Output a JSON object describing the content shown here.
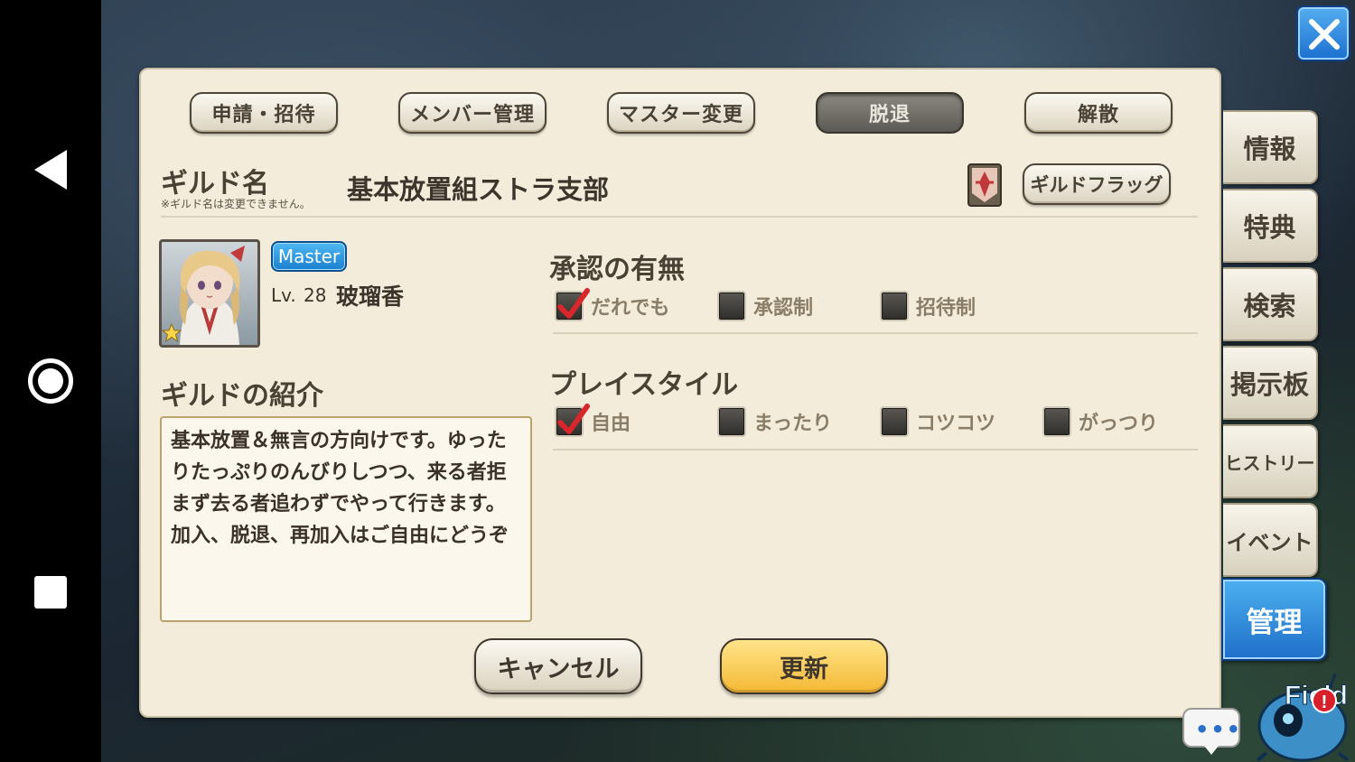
{
  "close_icon": "close-icon",
  "android_nav": {
    "back": "back-icon",
    "home": "home-icon",
    "recent": "recent-apps-icon"
  },
  "tabs": [
    {
      "label": "申請・招待",
      "active": false
    },
    {
      "label": "メンバー管理",
      "active": false
    },
    {
      "label": "マスター変更",
      "active": false
    },
    {
      "label": "脱退",
      "active": true
    },
    {
      "label": "解散",
      "active": false
    }
  ],
  "guild": {
    "name_label": "ギルド名",
    "name_note": "※ギルド名は変更できません。",
    "name": "基本放置組ストラ支部",
    "flag_button": "ギルドフラッグ"
  },
  "member": {
    "badge": "Master",
    "level_label": "Lv.",
    "level": "28",
    "name": "玻瑠香"
  },
  "intro": {
    "heading": "ギルドの紹介",
    "text": "基本放置＆無言の方向けです。ゆったりたっぷりのんびりしつつ、来る者拒まず去る者追わずでやって行きます。加入、脱退、再加入はご自由にどうぞ"
  },
  "approval": {
    "heading": "承認の有無",
    "options": [
      {
        "label": "だれでも",
        "checked": true
      },
      {
        "label": "承認制",
        "checked": false
      },
      {
        "label": "招待制",
        "checked": false
      }
    ]
  },
  "playstyle": {
    "heading": "プレイスタイル",
    "options": [
      {
        "label": "自由",
        "checked": true
      },
      {
        "label": "まったり",
        "checked": false
      },
      {
        "label": "コツコツ",
        "checked": false
      },
      {
        "label": "がっつり",
        "checked": false
      }
    ]
  },
  "footer": {
    "cancel": "キャンセル",
    "update": "更新"
  },
  "side_menu": [
    {
      "label": "情報",
      "active": false
    },
    {
      "label": "特典",
      "active": false
    },
    {
      "label": "検索",
      "active": false
    },
    {
      "label": "掲示板",
      "active": false
    },
    {
      "label": "ヒストリー",
      "active": false
    },
    {
      "label": "イベント",
      "active": false
    },
    {
      "label": "管理",
      "active": true
    }
  ],
  "chat": {
    "dots": "•••"
  },
  "mascot_text": "Field",
  "colors": {
    "accent_blue": "#1f6fc9",
    "update_yellow": "#f4b934",
    "panel": "#f3ecda"
  }
}
